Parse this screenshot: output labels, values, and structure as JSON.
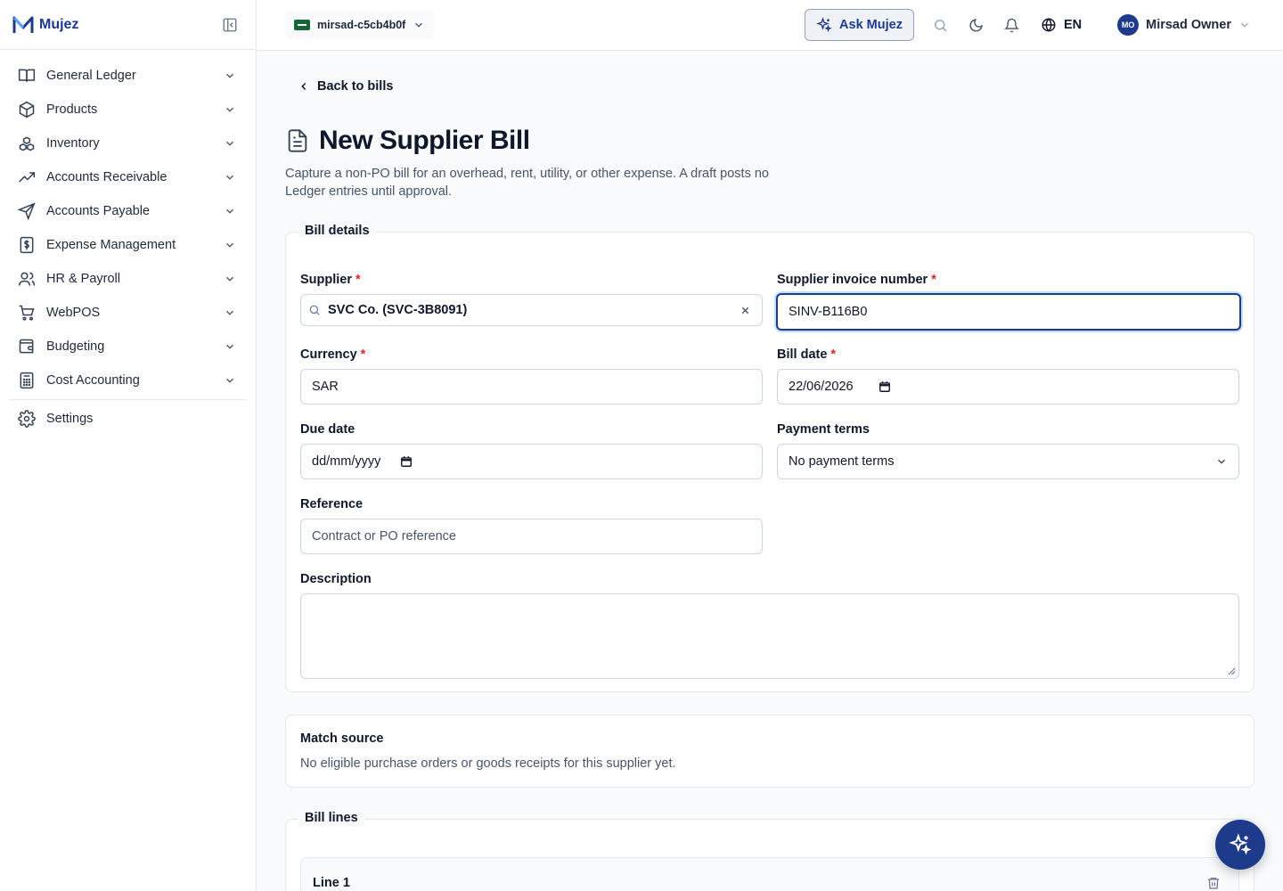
{
  "brand": {
    "name": "Mujez"
  },
  "sidebar": {
    "items": [
      {
        "label": "General Ledger",
        "icon": "book-open-icon"
      },
      {
        "label": "Products",
        "icon": "package-icon"
      },
      {
        "label": "Inventory",
        "icon": "boxes-icon"
      },
      {
        "label": "Accounts Receivable",
        "icon": "trending-up-icon"
      },
      {
        "label": "Accounts Payable",
        "icon": "send-icon"
      },
      {
        "label": "Expense Management",
        "icon": "receipt-icon"
      },
      {
        "label": "HR & Payroll",
        "icon": "users-icon"
      },
      {
        "label": "WebPOS",
        "icon": "cart-icon"
      },
      {
        "label": "Budgeting",
        "icon": "wallet-icon"
      },
      {
        "label": "Cost Accounting",
        "icon": "calculator-icon"
      }
    ],
    "settings": {
      "label": "Settings",
      "icon": "gear-icon"
    }
  },
  "topbar": {
    "org": "mirsad-c5cb4b0f",
    "ask_label": "Ask Mujez",
    "language": "EN",
    "user": {
      "initials": "MO",
      "name": "Mirsad Owner"
    }
  },
  "page": {
    "back_label": "Back to bills",
    "title": "New Supplier Bill",
    "subtitle": "Capture a non-PO bill for an overhead, rent, utility, or other expense. A draft posts no Ledger entries until approval."
  },
  "bill_details": {
    "legend": "Bill details",
    "supplier": {
      "label": "Supplier",
      "value": "SVC Co. (SVC-3B8091)"
    },
    "invoice_number": {
      "label": "Supplier invoice number",
      "value": "SINV-B116B0"
    },
    "currency": {
      "label": "Currency",
      "value": "SAR"
    },
    "bill_date": {
      "label": "Bill date",
      "value": "22/06/2026"
    },
    "due_date": {
      "label": "Due date",
      "placeholder": "dd/mm/yyyy"
    },
    "payment_terms": {
      "label": "Payment terms",
      "value": "No payment terms"
    },
    "reference": {
      "label": "Reference",
      "placeholder": "Contract or PO reference"
    },
    "description": {
      "label": "Description",
      "value": ""
    }
  },
  "match_source": {
    "title": "Match source",
    "message": "No eligible purchase orders or goods receipts for this supplier yet."
  },
  "bill_lines": {
    "legend": "Bill lines",
    "line_label": "Line 1"
  },
  "colors": {
    "accent": "#1e3a8a",
    "required": "#dc2626",
    "border": "#e2e8f0"
  }
}
